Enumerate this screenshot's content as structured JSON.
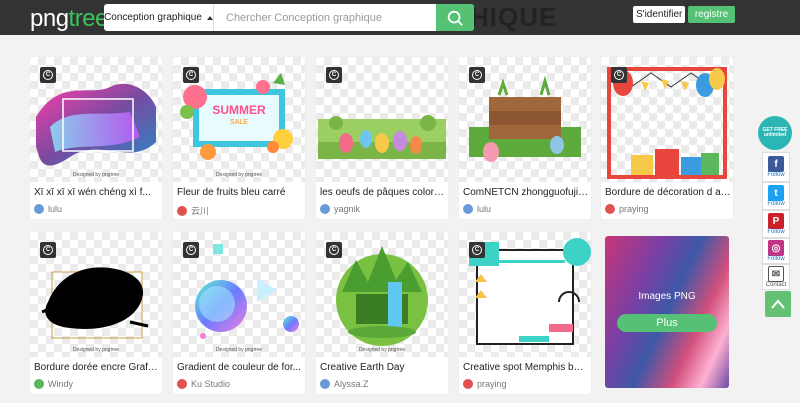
{
  "header": {
    "logo_main": "png",
    "logo_accent": "tree",
    "background_title": "HIQUE",
    "search_category": "Conception graphique",
    "search_placeholder": "Chercher Conception graphique",
    "login_label": "S'identifier",
    "register_label": "registre"
  },
  "watermark": "Designed by pngtree",
  "cards": [
    {
      "title": "Xī xī xī xī wén chéng xì f...",
      "author": "lulu",
      "avatar_color": "#6a9bd8"
    },
    {
      "title": "Fleur de fruits bleu carré",
      "author": "云川",
      "avatar_color": "#e0524f"
    },
    {
      "title": "les oeufs de pâques coloré...",
      "author": "yagnik",
      "avatar_color": "#6a9bd8"
    },
    {
      "title": "ComNETCN zhongguofujia...",
      "author": "lulu",
      "avatar_color": "#6a9bd8"
    },
    {
      "title": "Bordure de décoration d an...",
      "author": "praying",
      "avatar_color": "#e0524f"
    },
    {
      "title": "Bordure dorée encre Graffit...",
      "author": "Windy",
      "avatar_color": "#5cb85c"
    },
    {
      "title": "Gradient de couleur de for...",
      "author": "Ku Studio",
      "avatar_color": "#e0524f"
    },
    {
      "title": "Creative Earth Day",
      "author": "Alyssa.Z",
      "avatar_color": "#6a9bd8"
    },
    {
      "title": "Creative spot Memphis bac...",
      "author": "praying",
      "avatar_color": "#e0524f"
    }
  ],
  "summer_card": {
    "line1": "SUMMER",
    "line2": "SALE"
  },
  "promo": {
    "title": "Images PNG",
    "button": "Plus"
  },
  "sidebar": {
    "free_badge": "GET FREE unlimited",
    "items": [
      {
        "label": "Follow",
        "icon": "facebook-icon",
        "glyph": "f",
        "color": "#3b5998"
      },
      {
        "label": "Follow",
        "icon": "twitter-icon",
        "glyph": "t",
        "color": "#1da1f2"
      },
      {
        "label": "Follow",
        "icon": "pinterest-icon",
        "glyph": "P",
        "color": "#cb2027"
      },
      {
        "label": "Follow",
        "icon": "instagram-icon",
        "glyph": "◎",
        "color": "#c13584"
      },
      {
        "label": "Contact",
        "icon": "mail-icon",
        "glyph": "✉",
        "color": "#555555"
      }
    ]
  },
  "colors": {
    "accent": "#55c174",
    "header_bg": "#333333"
  }
}
